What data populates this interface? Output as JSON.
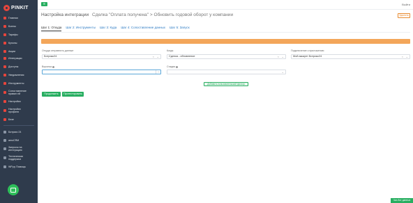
{
  "sidebar": {
    "logo_text": "PINKIT",
    "items": [
      {
        "label": "Главная",
        "icon": "home-icon"
      },
      {
        "label": "Бонны",
        "icon": "grid-icon"
      },
      {
        "label": "Тарифы",
        "icon": "tag-icon"
      },
      {
        "label": "Купоны",
        "icon": "ticket-icon"
      },
      {
        "label": "Акции",
        "icon": "megaphone-icon"
      },
      {
        "label": "Интеграции",
        "icon": "puzzle-icon"
      },
      {
        "label": "Доступы",
        "icon": "key-icon"
      },
      {
        "label": "Уведомления",
        "icon": "bell-icon"
      },
      {
        "label": "Инструменты",
        "icon": "wrench-icon"
      },
      {
        "label": "Сопоставление",
        "label2": "правил ей",
        "icon": "link-icon"
      },
      {
        "label": "Настройки",
        "icon": "gear-icon"
      },
      {
        "label": "Настройки",
        "label2": "профиля",
        "icon": "user-icon"
      },
      {
        "label": "Безе",
        "icon": "shield-icon"
      }
    ],
    "secondary_items": [
      {
        "label": "Битрикс 24",
        "icon": "cloud-icon"
      },
      {
        "label": "amoCRM",
        "icon": "crm-icon"
      },
      {
        "label": "Запросы на",
        "label2": "интеграцию",
        "icon": "request-icon"
      },
      {
        "label": "Техническая",
        "label2": "поддержка",
        "icon": "support-icon"
      },
      {
        "label": "WP.ру Помощь",
        "icon": "help-icon"
      }
    ]
  },
  "topbar": {
    "user_text": "Выйти"
  },
  "header": {
    "title": "Настройка интеграции",
    "subtitle": "Сделка \"Оплата получена\" > Обновить годовой оборот у компании",
    "link_label": "Удалить"
  },
  "tabs": [
    {
      "label": "Шаг 1: Откуда",
      "active": true
    },
    {
      "label": "Шаг 2: Инструменты",
      "active": false
    },
    {
      "label": "Шаг 3: Куда",
      "active": false
    },
    {
      "label": "Шаг 4: Сопоставление данных",
      "active": false
    },
    {
      "label": "Шаг 5: Запуск",
      "active": false
    }
  ],
  "banner": {
    "text": ""
  },
  "form": {
    "source": {
      "label": "Откуда отправлять данные",
      "value": "Битрикс24"
    },
    "event": {
      "label": "Когда",
      "value": "Сделка - обновление"
    },
    "connection": {
      "label": "Подключение к приложению",
      "value": "Мой аккаунт Битрикс24"
    },
    "funnel": {
      "label": "Воронка",
      "value": ""
    },
    "stage": {
      "label": "Стадия",
      "value": ""
    },
    "add_filter_label": "Добавить пользовательский фильтр"
  },
  "buttons": {
    "continue_label": "Продолжить",
    "test_label": "Протестировать"
  },
  "bottom_badge": "Чат-бот данных",
  "colors": {
    "sidebar_bg": "#2f3b4c",
    "accent_green": "#27ae60",
    "banner_orange": "#f3a65a",
    "logo_red": "#e8453c",
    "link_blue": "#2d7bc4"
  }
}
